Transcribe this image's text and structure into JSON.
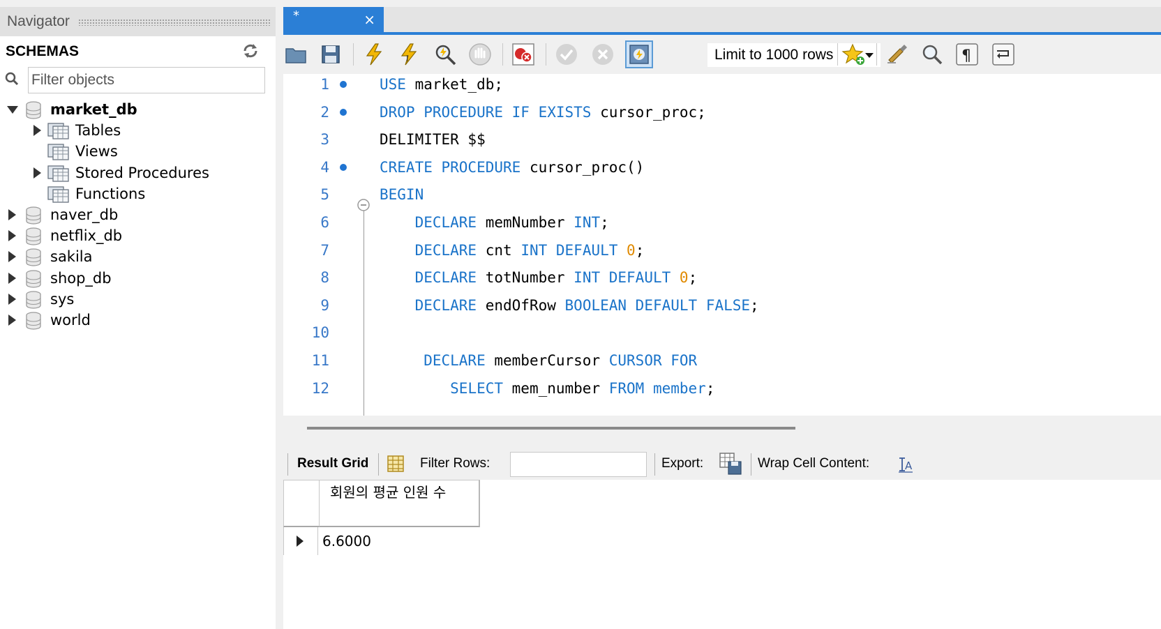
{
  "navigator": {
    "title": "Navigator",
    "schemas_label": "SCHEMAS",
    "filter_placeholder": "Filter objects",
    "schemas": [
      {
        "name": "market_db",
        "expanded": true,
        "children": [
          "Tables",
          "Views",
          "Stored Procedures",
          "Functions"
        ]
      },
      {
        "name": "naver_db"
      },
      {
        "name": "netflix_db"
      },
      {
        "name": "sakila"
      },
      {
        "name": "shop_db"
      },
      {
        "name": "sys"
      },
      {
        "name": "world"
      }
    ]
  },
  "editor_tab": {
    "title": "*",
    "close": "×"
  },
  "toolbar": {
    "limit_value": "Limit to 1000 rows",
    "icons": [
      "open-file-icon",
      "save-icon",
      "execute-icon",
      "execute-current-icon",
      "explain-icon",
      "stop-icon",
      "error-toggle-icon",
      "commit-icon",
      "rollback-icon",
      "autocommit-icon",
      "bookmark-icon",
      "beautify-icon",
      "find-icon",
      "invisible-chars-icon",
      "wrap-icon"
    ]
  },
  "code": {
    "lines": [
      {
        "n": "1",
        "marker": true,
        "tokens": [
          {
            "t": "USE",
            "k": "kw"
          },
          {
            "t": " market_db;"
          }
        ]
      },
      {
        "n": "2",
        "marker": true,
        "tokens": [
          {
            "t": "DROP PROCEDURE IF EXISTS",
            "k": "kw"
          },
          {
            "t": " cursor_proc;"
          }
        ]
      },
      {
        "n": "3",
        "marker": false,
        "tokens": [
          {
            "t": "DELIMITER $$"
          }
        ]
      },
      {
        "n": "4",
        "marker": true,
        "tokens": [
          {
            "t": "CREATE PROCEDURE",
            "k": "kw"
          },
          {
            "t": " cursor_proc()"
          }
        ]
      },
      {
        "n": "5",
        "marker": false,
        "fold": true,
        "tokens": [
          {
            "t": "BEGIN",
            "k": "kw"
          }
        ]
      },
      {
        "n": "6",
        "marker": false,
        "tokens": [
          {
            "t": "    "
          },
          {
            "t": "DECLARE",
            "k": "kw"
          },
          {
            "t": " memNumber "
          },
          {
            "t": "INT",
            "k": "kw"
          },
          {
            "t": ";"
          }
        ]
      },
      {
        "n": "7",
        "marker": false,
        "tokens": [
          {
            "t": "    "
          },
          {
            "t": "DECLARE",
            "k": "kw"
          },
          {
            "t": " cnt "
          },
          {
            "t": "INT DEFAULT",
            "k": "kw"
          },
          {
            "t": " "
          },
          {
            "t": "0",
            "k": "num"
          },
          {
            "t": ";"
          }
        ]
      },
      {
        "n": "8",
        "marker": false,
        "tokens": [
          {
            "t": "    "
          },
          {
            "t": "DECLARE",
            "k": "kw"
          },
          {
            "t": " totNumber "
          },
          {
            "t": "INT DEFAULT",
            "k": "kw"
          },
          {
            "t": " "
          },
          {
            "t": "0",
            "k": "num"
          },
          {
            "t": ";"
          }
        ]
      },
      {
        "n": "9",
        "marker": false,
        "tokens": [
          {
            "t": "    "
          },
          {
            "t": "DECLARE",
            "k": "kw"
          },
          {
            "t": " endOfRow "
          },
          {
            "t": "BOOLEAN DEFAULT FALSE",
            "k": "kw"
          },
          {
            "t": ";"
          }
        ]
      },
      {
        "n": "10",
        "marker": false,
        "tokens": []
      },
      {
        "n": "11",
        "marker": false,
        "tokens": [
          {
            "t": "     "
          },
          {
            "t": "DECLARE",
            "k": "kw"
          },
          {
            "t": " memberCursor "
          },
          {
            "t": "CURSOR FOR",
            "k": "kw"
          }
        ]
      },
      {
        "n": "12",
        "marker": false,
        "tokens": [
          {
            "t": "        "
          },
          {
            "t": "SELECT",
            "k": "kw"
          },
          {
            "t": " mem_number "
          },
          {
            "t": "FROM",
            "k": "kw"
          },
          {
            "t": " "
          },
          {
            "t": "member",
            "k": "kw"
          },
          {
            "t": ";"
          }
        ]
      }
    ]
  },
  "results": {
    "result_grid_label": "Result Grid",
    "filter_rows_label": "Filter Rows:",
    "export_label": "Export:",
    "wrap_label": "Wrap Cell Content:",
    "column_header": "회원의 평균 인원 수",
    "rows": [
      "6.6000"
    ]
  },
  "colors": {
    "accent": "#2b7fd6",
    "keyword": "#1a73c9",
    "number": "#e08a00",
    "line_number": "#3878c8"
  }
}
